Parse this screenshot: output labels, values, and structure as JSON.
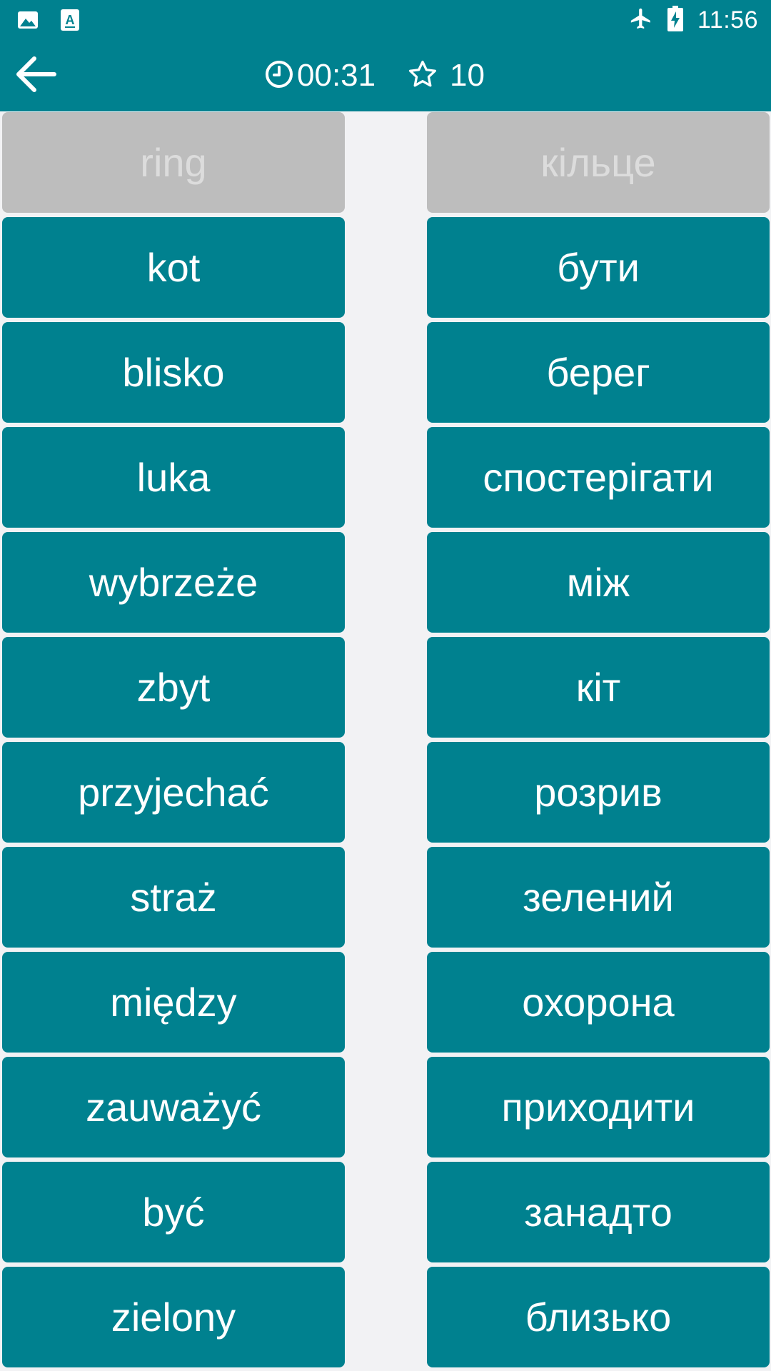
{
  "status_bar": {
    "time": "11:56",
    "left_icons": [
      "image-icon",
      "text-a-icon"
    ],
    "right_icons": [
      "airplane-icon",
      "battery-charging-icon"
    ]
  },
  "toolbar": {
    "back_icon": "arrow-left-icon",
    "timer": "00:31",
    "timer_icon": "clock-icon",
    "score": "10",
    "score_icon": "star-outline-icon"
  },
  "colors": {
    "primary": "#00818f",
    "matched": "#bdbdbd",
    "matched_text": "#dcdcdc",
    "background": "#f2f2f4"
  },
  "left_words": [
    {
      "text": "ring",
      "matched": true
    },
    {
      "text": "kot",
      "matched": false
    },
    {
      "text": "blisko",
      "matched": false
    },
    {
      "text": "luka",
      "matched": false
    },
    {
      "text": "wybrzeże",
      "matched": false
    },
    {
      "text": "zbyt",
      "matched": false
    },
    {
      "text": "przyjechać",
      "matched": false
    },
    {
      "text": "straż",
      "matched": false
    },
    {
      "text": "między",
      "matched": false
    },
    {
      "text": "zauważyć",
      "matched": false
    },
    {
      "text": "być",
      "matched": false
    },
    {
      "text": "zielony",
      "matched": false
    }
  ],
  "right_words": [
    {
      "text": "кільце",
      "matched": true
    },
    {
      "text": "бути",
      "matched": false
    },
    {
      "text": "берег",
      "matched": false
    },
    {
      "text": "спостерігати",
      "matched": false
    },
    {
      "text": "між",
      "matched": false
    },
    {
      "text": "кіт",
      "matched": false
    },
    {
      "text": "розрив",
      "matched": false
    },
    {
      "text": "зелений",
      "matched": false
    },
    {
      "text": "охорона",
      "matched": false
    },
    {
      "text": "приходити",
      "matched": false
    },
    {
      "text": "занадто",
      "matched": false
    },
    {
      "text": "близько",
      "matched": false
    }
  ]
}
